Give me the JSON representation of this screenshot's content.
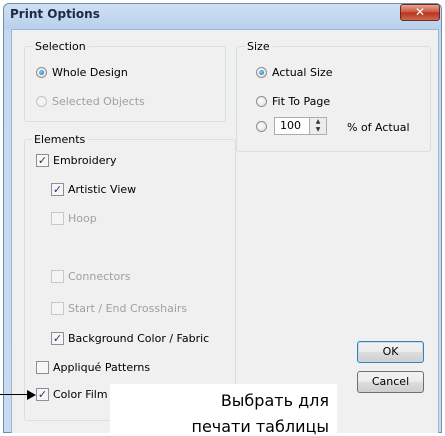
{
  "window": {
    "title": "Print Options",
    "close_glyph": "✕"
  },
  "selection": {
    "label": "Selection",
    "options": [
      {
        "label": "Whole Design",
        "checked": true,
        "enabled": true
      },
      {
        "label": "Selected Objects",
        "checked": false,
        "enabled": false
      }
    ]
  },
  "size": {
    "label": "Size",
    "options": [
      {
        "label": "Actual Size",
        "checked": true
      },
      {
        "label": "Fit To Page",
        "checked": false
      },
      {
        "label": "% of Actual",
        "checked": false
      }
    ],
    "percent_value": "100"
  },
  "elements": {
    "label": "Elements",
    "items": [
      {
        "label": "Embroidery",
        "checked": true,
        "enabled": true
      },
      {
        "label": "Artistic View",
        "checked": true,
        "enabled": true
      },
      {
        "label": "Hoop",
        "checked": false,
        "enabled": false
      },
      {
        "label": "Connectors",
        "checked": false,
        "enabled": false
      },
      {
        "label": "Start / End Crosshairs",
        "checked": false,
        "enabled": false
      },
      {
        "label": "Background Color / Fabric",
        "checked": true,
        "enabled": true
      },
      {
        "label": "Appliqué Patterns",
        "checked": false,
        "enabled": true
      },
      {
        "label": "Color Film",
        "checked": true,
        "enabled": true
      }
    ]
  },
  "buttons": {
    "ok": "OK",
    "cancel": "Cancel"
  },
  "callout": {
    "line1": "Выбрать для",
    "line2": "печати таблицы"
  },
  "check_glyph": "✓"
}
